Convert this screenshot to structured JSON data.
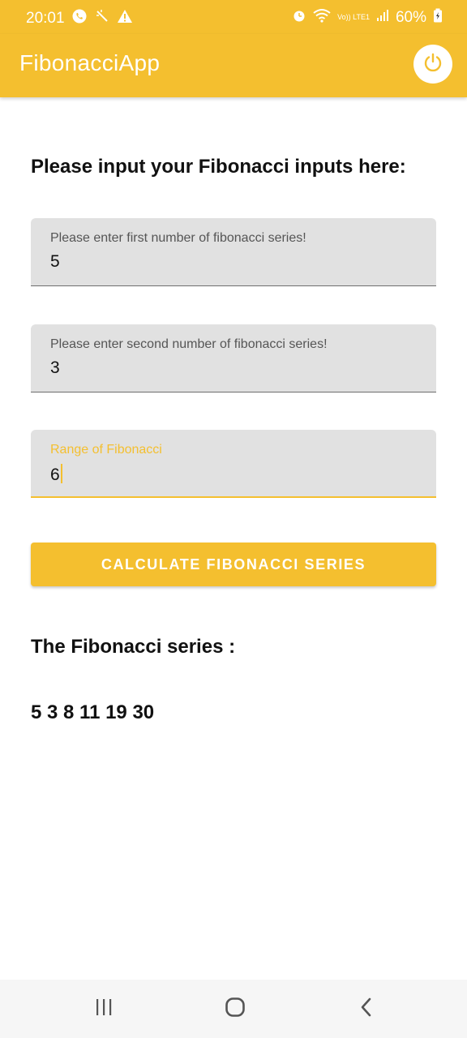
{
  "status_bar": {
    "time": "20:01",
    "left_icons": [
      "whatsapp-icon",
      "magic-wand-icon",
      "warning-icon"
    ],
    "right_icons": [
      "alarm-icon",
      "wifi-icon",
      "volte-icon",
      "signal-icon",
      "battery-icon"
    ],
    "lte_label": "Vo)) LTE1",
    "battery": "60%"
  },
  "app_bar": {
    "title": "FibonacciApp",
    "power_icon": "power-icon"
  },
  "form": {
    "heading": "Please input your Fibonacci inputs here:",
    "first_field": {
      "label": "Please enter first number of fibonacci series!",
      "value": "5"
    },
    "second_field": {
      "label": "Please enter second number of fibonacci series!",
      "value": "3"
    },
    "range_field": {
      "label": "Range of Fibonacci",
      "value": "6"
    },
    "calculate_button": "CALCULATE FIBONACCI SERIES"
  },
  "result": {
    "title": "The Fibonacci series :",
    "values": "5 3 8 11 19 30"
  },
  "nav_bar": {
    "icons": [
      "recent-apps-icon",
      "home-icon",
      "back-icon"
    ]
  },
  "colors": {
    "accent": "#f4bf2f",
    "field_bg": "#e1e1e1",
    "text": "#111111"
  }
}
